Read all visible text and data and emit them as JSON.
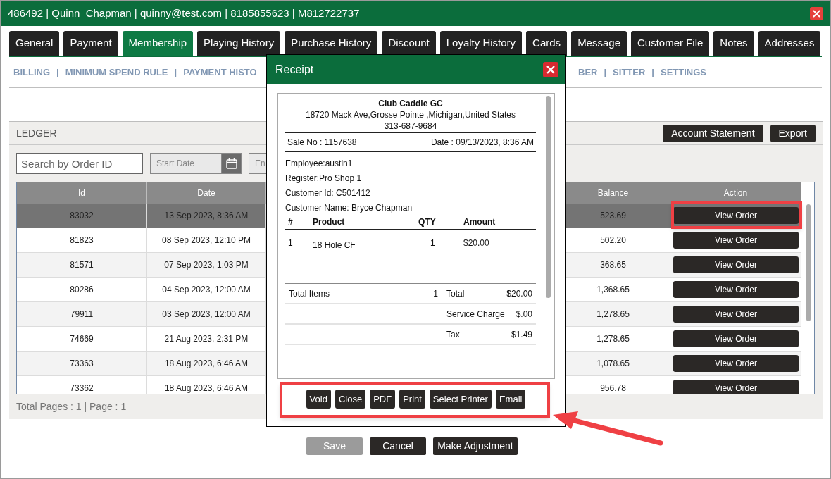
{
  "window": {
    "title": "486492 | Quinn  Chapman | quinny@test.com | 8185855623 | M812722737"
  },
  "tabs": [
    {
      "label": "General",
      "selected": false
    },
    {
      "label": "Payment",
      "selected": false
    },
    {
      "label": "Membership",
      "selected": true
    },
    {
      "label": "Playing History",
      "selected": false
    },
    {
      "label": "Purchase History",
      "selected": false
    },
    {
      "label": "Discount",
      "selected": false
    },
    {
      "label": "Loyalty History",
      "selected": false
    },
    {
      "label": "Cards",
      "selected": false
    },
    {
      "label": "Message",
      "selected": false
    },
    {
      "label": "Customer File",
      "selected": false
    },
    {
      "label": "Notes",
      "selected": false
    },
    {
      "label": "Addresses",
      "selected": false
    }
  ],
  "subnav": {
    "left": [
      "BILLING",
      "|",
      "MINIMUM SPEND RULE",
      "|",
      "PAYMENT HISTO"
    ],
    "right": [
      "BER",
      "|",
      "SITTER",
      "|",
      "SETTINGS"
    ]
  },
  "ledger": {
    "title": "LEDGER",
    "buttons": [
      "Account Statement",
      "Export"
    ],
    "search": {
      "placeholder": "Search by Order ID"
    },
    "start_date": {
      "placeholder": "Start Date"
    },
    "end_date": {
      "placeholder": "En"
    },
    "table": {
      "columns": [
        "Id",
        "Date",
        "Balance",
        "Action"
      ],
      "rows": [
        {
          "id": "83032",
          "date": "13 Sep 2023, 8:36 AM",
          "balance": "523.69",
          "action": "View Order",
          "selected": true,
          "highlighted": true
        },
        {
          "id": "81823",
          "date": "08 Sep 2023, 12:10 PM",
          "balance": "502.20",
          "action": "View Order",
          "selected": false,
          "highlighted": false
        },
        {
          "id": "81571",
          "date": "07 Sep 2023, 1:03 PM",
          "balance": "368.65",
          "action": "View Order",
          "selected": false,
          "highlighted": false
        },
        {
          "id": "80286",
          "date": "04 Sep 2023, 12:00 AM",
          "balance": "1,368.65",
          "action": "View Order",
          "selected": false,
          "highlighted": false
        },
        {
          "id": "79911",
          "date": "03 Sep 2023, 12:00 AM",
          "balance": "1,278.65",
          "action": "View Order",
          "selected": false,
          "highlighted": false
        },
        {
          "id": "74669",
          "date": "21 Aug 2023, 2:31 PM",
          "balance": "1,278.65",
          "action": "View Order",
          "selected": false,
          "highlighted": false
        },
        {
          "id": "73363",
          "date": "18 Aug 2023, 6:46 AM",
          "balance": "1,078.65",
          "action": "View Order",
          "selected": false,
          "highlighted": false
        },
        {
          "id": "73362",
          "date": "18 Aug 2023, 6:46 AM",
          "balance": "956.78",
          "action": "View Order",
          "selected": false,
          "highlighted": false
        }
      ]
    },
    "footer": "Total Pages : 1 | Page : 1"
  },
  "actions": [
    {
      "label": "Save",
      "disabled": true
    },
    {
      "label": "Cancel",
      "disabled": false
    },
    {
      "label": "Make Adjustment",
      "disabled": false
    }
  ],
  "receipt": {
    "title": "Receipt",
    "business": {
      "name": "Club Caddie GC",
      "address": "18720 Mack Ave,Grosse Pointe ,Michigan,United States",
      "phone": "313-687-9684"
    },
    "sale_no": "Sale No : 1157638",
    "date": "Date : 09/13/2023, 8:36 AM",
    "info": [
      "Employee:austin1",
      "Register:Pro Shop 1",
      "Customer Id: C501412",
      "Customer Name: Bryce Chapman"
    ],
    "columns": [
      "#",
      "Product",
      "QTY",
      "Amount"
    ],
    "items": [
      [
        "1",
        "18 Hole CF",
        "1",
        "$20.00"
      ]
    ],
    "totals": [
      {
        "caption": "Total Items",
        "count": "1",
        "label": "Total",
        "value": "$20.00"
      },
      {
        "label": "Service Charge",
        "value": "$.00"
      },
      {
        "label": "Tax",
        "value": "$1.49"
      }
    ],
    "buttons": [
      "Void",
      "Close",
      "PDF",
      "Print",
      "Select Printer",
      "Email"
    ],
    "buttons_highlighted": true
  }
}
